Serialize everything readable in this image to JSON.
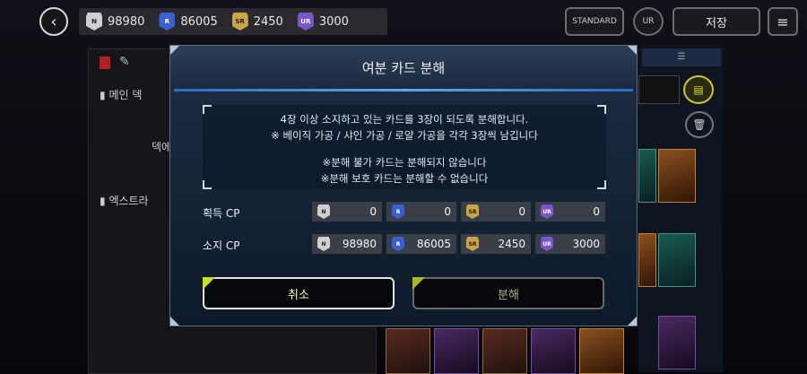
{
  "topbar": {
    "back_icon": "chevron-left-icon",
    "cp": [
      {
        "rarity": "N",
        "value": "98980"
      },
      {
        "rarity": "R",
        "value": "86005"
      },
      {
        "rarity": "SR",
        "value": "2450"
      },
      {
        "rarity": "UR",
        "value": "3000"
      }
    ],
    "standard_label": "STANDARD",
    "ur_label": "UR",
    "save_label": "저장",
    "menu_icon": "hamburger-menu-icon"
  },
  "sidebar": {
    "items": [
      {
        "label": "메인 덱"
      },
      {
        "label": "덱에"
      },
      {
        "label": "엑스트라"
      }
    ]
  },
  "modal": {
    "title": "여분 카드 분해",
    "info_lines": [
      "4장 이상 소지하고 있는 카드를 3장이 되도록 분해합니다.",
      "※ 베이직 가공 / 샤인 가공 / 로얄 가공을 각각 3장씩 남깁니다",
      "※분해 불가 카드는 분해되지 않습니다",
      "※분해 보호 카드는 분해할 수 없습니다"
    ],
    "acquire_label": "획득 CP",
    "own_label": "소지 CP",
    "acquire": [
      {
        "rarity": "N",
        "value": "0"
      },
      {
        "rarity": "R",
        "value": "0"
      },
      {
        "rarity": "SR",
        "value": "0"
      },
      {
        "rarity": "UR",
        "value": "0"
      }
    ],
    "own": [
      {
        "rarity": "N",
        "value": "98980"
      },
      {
        "rarity": "R",
        "value": "86005"
      },
      {
        "rarity": "SR",
        "value": "2450"
      },
      {
        "rarity": "UR",
        "value": "3000"
      }
    ],
    "cancel_label": "취소",
    "dismantle_label": "분해"
  },
  "colors": {
    "accent_line": "#5aa8f0",
    "button_accent": "#c8e020"
  }
}
